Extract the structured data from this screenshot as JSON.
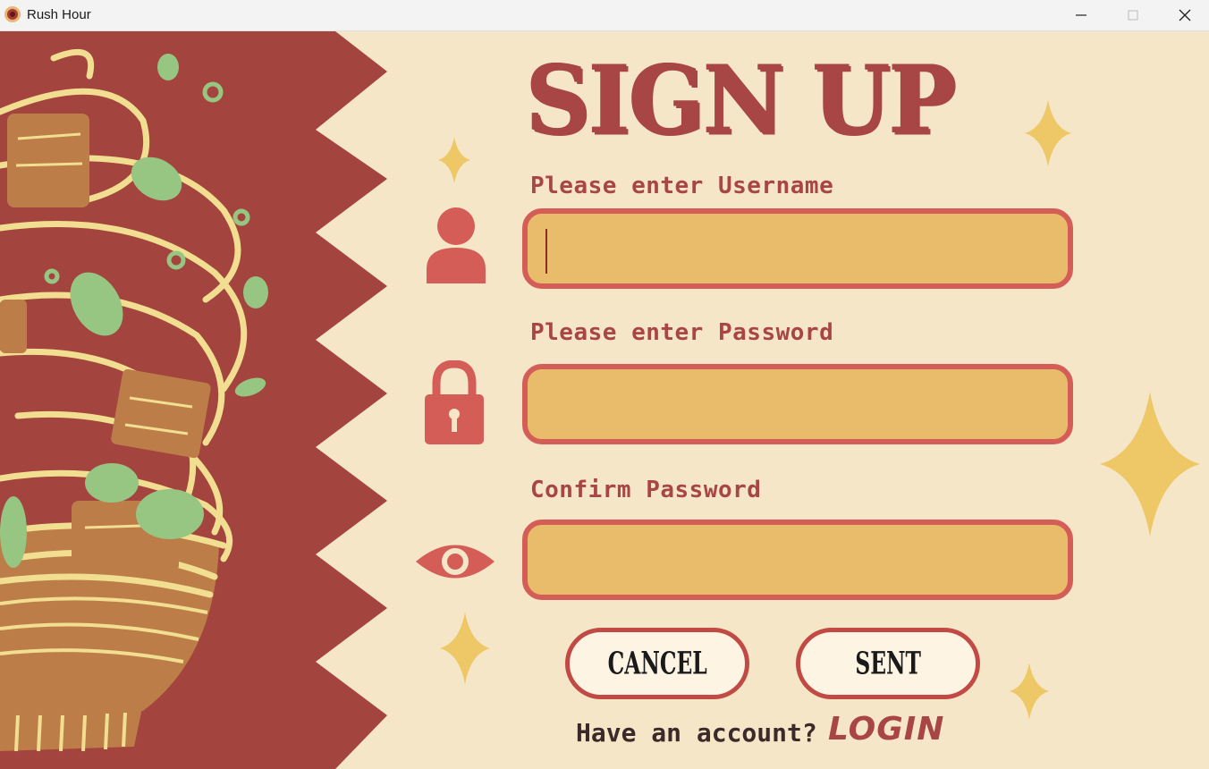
{
  "window": {
    "title": "Rush Hour",
    "controls": [
      "minimize",
      "maximize",
      "close"
    ]
  },
  "form": {
    "title": "SIGN UP",
    "fields": [
      {
        "label": "Please enter Username",
        "icon": "user-icon",
        "value": ""
      },
      {
        "label": "Please enter Password",
        "icon": "lock-icon",
        "value": ""
      },
      {
        "label": "Confirm Password",
        "icon": "eye-icon",
        "value": ""
      }
    ],
    "cancel_label": "CANCEL",
    "sent_label": "SENT"
  },
  "footer": {
    "prompt": "Have an account?",
    "login_label": "LOGIN"
  },
  "colors": {
    "background": "#f6e6c8",
    "accent": "#a84545",
    "field_fill": "#e9bc6c",
    "field_border": "#d45e57",
    "sparkle": "#eec766",
    "art_backdrop": "#a3443e"
  }
}
